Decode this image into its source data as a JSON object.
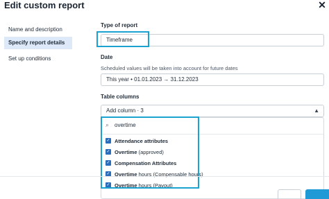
{
  "window": {
    "title": "Edit custom report",
    "close_icon": "close-icon"
  },
  "sidebar": {
    "items": [
      {
        "label": "Name and description",
        "active": false
      },
      {
        "label": "Specify report details",
        "active": true
      },
      {
        "label": "Set up conditions",
        "active": false
      }
    ]
  },
  "type_of_report": {
    "label": "Type of report",
    "value": "Timeframe"
  },
  "date": {
    "label": "Date",
    "hint": "Scheduled values will be taken into account for future dates",
    "value": "This year • 01.01.2023 → 31.12.2023"
  },
  "table_columns": {
    "label": "Table columns",
    "select_value": "Add column · 3",
    "search_value": "overtime",
    "options": [
      {
        "bold": "Attendance attributes",
        "rest": "",
        "checked": true
      },
      {
        "bold": "Overtime",
        "rest": " (approved)",
        "checked": true
      },
      {
        "bold": "Compensation Attributes",
        "rest": "",
        "checked": true
      },
      {
        "bold": "Overtime",
        "rest": " hours (Compensable hours)",
        "checked": true
      },
      {
        "bold": "Overtime",
        "rest": " hours (Payout)",
        "checked": true
      }
    ]
  },
  "colors": {
    "accent": "#1aa3d1",
    "checkbox": "#2a6ebb",
    "active_nav": "#dde9f8"
  }
}
